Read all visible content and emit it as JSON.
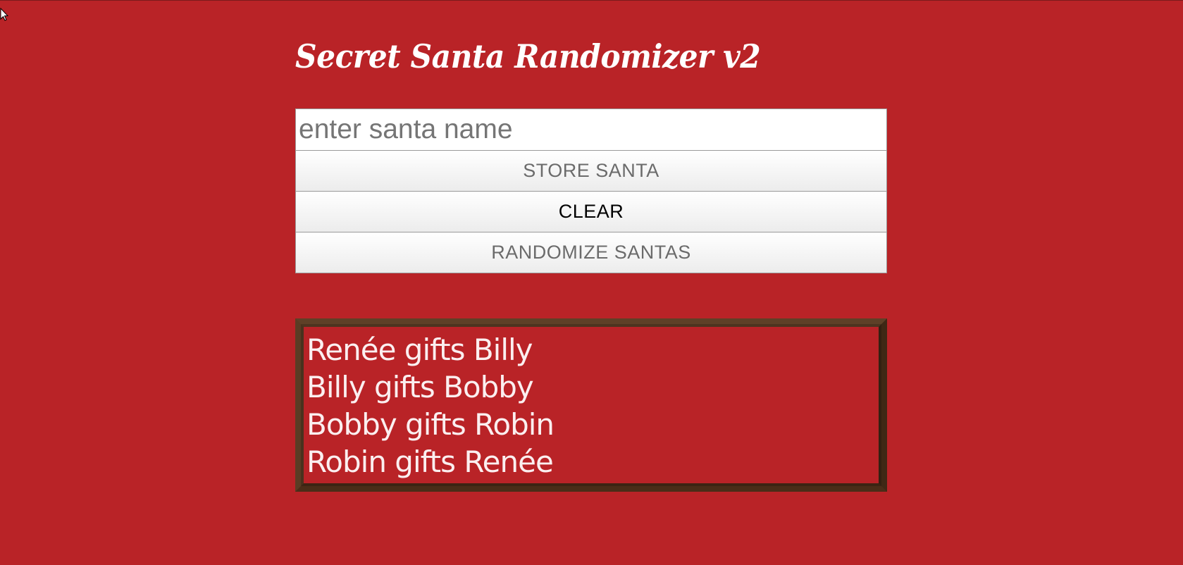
{
  "app": {
    "title": "Secret Santa Randomizer v2"
  },
  "form": {
    "input_placeholder": "enter santa name",
    "input_value": "",
    "buttons": {
      "store": "STORE SANTA",
      "clear": "CLEAR",
      "randomize": "RANDOMIZE SANTAS"
    }
  },
  "results": {
    "pairs": [
      "Renée gifts Billy",
      "Billy gifts Bobby",
      "Bobby gifts Robin",
      "Robin gifts Renée"
    ]
  },
  "colors": {
    "background": "#b92327",
    "frame": "#5e4027",
    "text": "#ffffff"
  },
  "icons": {
    "cursor": "mouse-pointer-icon"
  }
}
